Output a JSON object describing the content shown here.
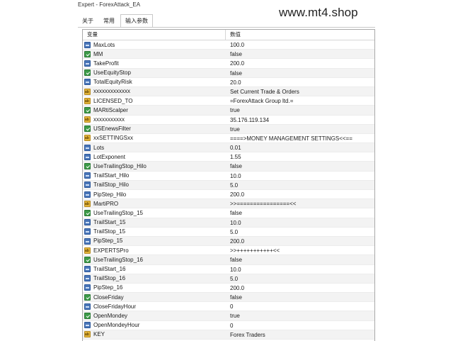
{
  "window": {
    "title": "Expert - ForexAttack_EA"
  },
  "watermark": "www.mt4.shop",
  "tabs": [
    {
      "label": "关于"
    },
    {
      "label": "常用"
    },
    {
      "label": "输入参数"
    }
  ],
  "grid": {
    "headers": {
      "variable": "变量",
      "value": "数值"
    },
    "rows": [
      {
        "name": "MaxLots",
        "value": "100.0",
        "type": "num"
      },
      {
        "name": "MM",
        "value": "false",
        "type": "bool"
      },
      {
        "name": "TakeProfit",
        "value": "200.0",
        "type": "num"
      },
      {
        "name": "UseEquityStop",
        "value": "false",
        "type": "bool"
      },
      {
        "name": "TotalEquityRisk",
        "value": "20.0",
        "type": "num"
      },
      {
        "name": "xxxxxxxxxxxxx",
        "value": "Set Current Trade & Orders",
        "type": "str"
      },
      {
        "name": "LICENSED_TO",
        "value": "=ForexAttack Group ltd.=",
        "type": "str"
      },
      {
        "name": "MARtiScalper",
        "value": "true",
        "type": "bool"
      },
      {
        "name": "xxxxxxxxxxx",
        "value": "35.176.119.134",
        "type": "str"
      },
      {
        "name": "USEnewsFilter",
        "value": "true",
        "type": "bool"
      },
      {
        "name": "xxSETTINGSxx",
        "value": "====>MONEY MANAGEMENT SETTINGS<<==",
        "type": "str"
      },
      {
        "name": "Lots",
        "value": "0.01",
        "type": "num"
      },
      {
        "name": "LotExponent",
        "value": "1.55",
        "type": "num"
      },
      {
        "name": "UseTrailingStop_Hilo",
        "value": "false",
        "type": "bool"
      },
      {
        "name": "TrailStart_Hilo",
        "value": "10.0",
        "type": "num"
      },
      {
        "name": "TrailStop_Hilo",
        "value": "5.0",
        "type": "num"
      },
      {
        "name": "PipStep_Hilo",
        "value": "200.0",
        "type": "num"
      },
      {
        "name": "MartiPRO",
        "value": ">>================<<",
        "type": "str"
      },
      {
        "name": "UseTrailingStop_15",
        "value": "false",
        "type": "bool"
      },
      {
        "name": "TrailStart_15",
        "value": "10.0",
        "type": "num"
      },
      {
        "name": "TrailStop_15",
        "value": "5.0",
        "type": "num"
      },
      {
        "name": "PipStep_15",
        "value": "200.0",
        "type": "num"
      },
      {
        "name": "EXPERTSPro",
        "value": ">>+++++++++++<<",
        "type": "str"
      },
      {
        "name": "UseTrailingStop_16",
        "value": "false",
        "type": "bool"
      },
      {
        "name": "TrailStart_16",
        "value": "10.0",
        "type": "num"
      },
      {
        "name": "TrailStop_16",
        "value": "5.0",
        "type": "num"
      },
      {
        "name": "PipStep_16",
        "value": "200.0",
        "type": "num"
      },
      {
        "name": "CloseFriday",
        "value": "false",
        "type": "bool"
      },
      {
        "name": "CloseFridayHour",
        "value": "0",
        "type": "num"
      },
      {
        "name": "OpenMondey",
        "value": "true",
        "type": "bool"
      },
      {
        "name": "OpenMondeyHour",
        "value": "0",
        "type": "num"
      },
      {
        "name": "KEY",
        "value": "Forex Traders",
        "type": "str"
      }
    ]
  }
}
